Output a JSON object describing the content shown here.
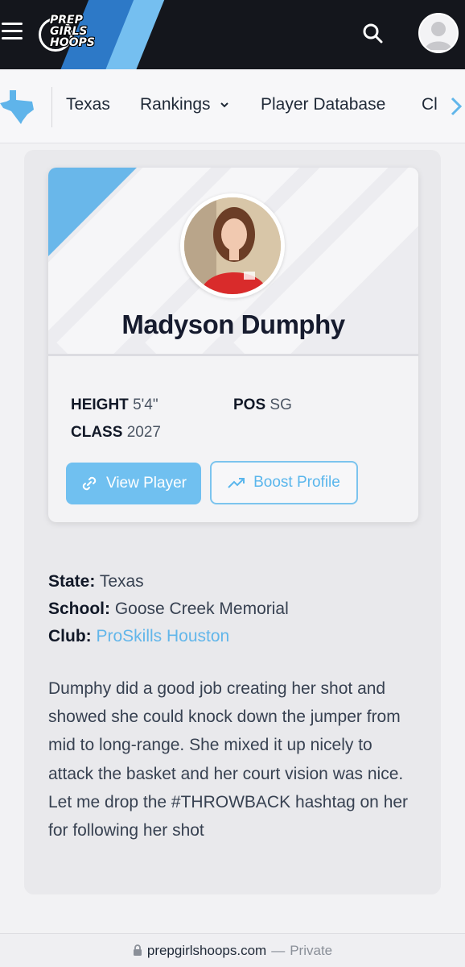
{
  "header": {
    "logo_text": "PREP GIRLS HOOPS",
    "menu_icon": "hamburger-icon",
    "search_icon": "search-icon",
    "avatar_icon": "user-avatar-icon",
    "colors": {
      "bg": "#14161c",
      "accent_dark": "#2d79c7",
      "accent_light": "#75bff0"
    }
  },
  "nav": {
    "state_icon": "texas-map-icon",
    "items": [
      {
        "label": "Texas"
      },
      {
        "label": "Rankings",
        "has_dropdown": true
      },
      {
        "label": "Player Database"
      },
      {
        "label": "Cl"
      }
    ],
    "scroll_icon": "chevron-right-icon"
  },
  "player": {
    "name": "Madyson Dumphy",
    "height_label": "HEIGHT",
    "height_value": "5'4\"",
    "pos_label": "POS",
    "pos_value": "SG",
    "class_label": "CLASS",
    "class_value": "2027",
    "view_button": "View Player",
    "boost_button": "Boost Profile"
  },
  "info": {
    "state_label": "State:",
    "state_value": "Texas",
    "school_label": "School:",
    "school_value": "Goose Creek Memorial",
    "club_label": "Club:",
    "club_value": "ProSkills Houston"
  },
  "description": "Dumphy did a good job creating her shot and showed she could knock down the jumper from mid to long-range. She mixed it up nicely to attack the basket and her court vision was nice. Let me drop the #THROWBACK hashtag on her for following her shot",
  "browser": {
    "url": "prepgirlshoops.com",
    "separator": "—",
    "mode": "Private",
    "lock_icon": "lock-icon"
  },
  "colors": {
    "accent": "#70c0f0",
    "link": "#62b6ea",
    "text": "#374151"
  }
}
